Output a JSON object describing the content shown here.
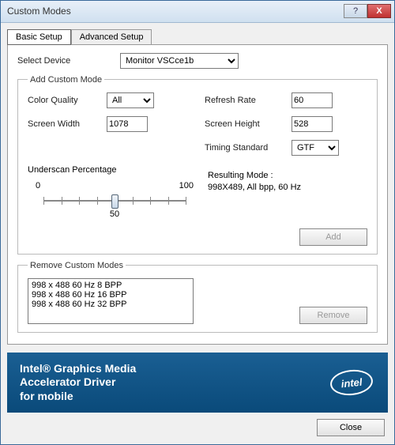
{
  "window": {
    "title": "Custom Modes"
  },
  "tabs": {
    "basic": "Basic Setup",
    "advanced": "Advanced Setup"
  },
  "device": {
    "label": "Select Device",
    "value": "Monitor VSCce1b"
  },
  "addGroup": {
    "legend": "Add Custom Mode",
    "colorQuality": {
      "label": "Color Quality",
      "value": "All"
    },
    "refreshRate": {
      "label": "Refresh Rate",
      "value": "60"
    },
    "screenWidth": {
      "label": "Screen Width",
      "value": "1078"
    },
    "screenHeight": {
      "label": "Screen Height",
      "value": "528"
    },
    "timingStandard": {
      "label": "Timing Standard",
      "value": "GTF"
    },
    "underscan": {
      "label": "Underscan Percentage",
      "min": "0",
      "max": "100",
      "center": "50"
    },
    "resulting": {
      "label": "Resulting Mode :",
      "value": "998X489, All bpp, 60 Hz"
    },
    "addButton": "Add"
  },
  "removeGroup": {
    "legend": "Remove Custom Modes",
    "items": [
      "998 x 488 60 Hz 8 BPP",
      "998 x 488 60 Hz 16 BPP",
      "998 x 488 60 Hz 32 BPP"
    ],
    "removeButton": "Remove"
  },
  "banner": {
    "line1": "Intel® Graphics Media",
    "line2": "Accelerator Driver",
    "line3": "for mobile",
    "logo": "intel"
  },
  "footer": {
    "closeButton": "Close"
  }
}
